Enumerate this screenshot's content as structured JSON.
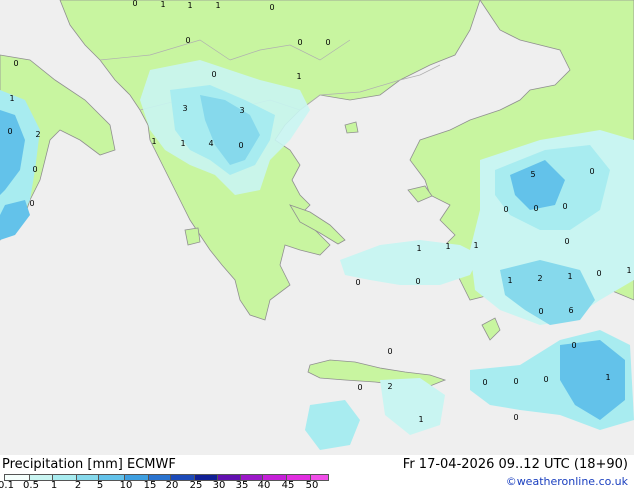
{
  "title": "Precipitation [mm]  ECMWF",
  "valid": "Fr 17-04-2026 09..12 UTC (18+90)",
  "credit": "©weatheronline.co.uk",
  "legend": {
    "ticks": [
      "0.1",
      "0.5",
      "1",
      "2",
      "5",
      "10",
      "15",
      "20",
      "25",
      "30",
      "35",
      "40",
      "45",
      "50"
    ],
    "colors": [
      "#f5fffd",
      "#c9f5f2",
      "#a8ecf0",
      "#86d9ec",
      "#63c2ea",
      "#3f9fe0",
      "#2a73cf",
      "#1c4ab8",
      "#101f95",
      "#6210b0",
      "#9b18c8",
      "#c520d8",
      "#e12ee0",
      "#f04ee8"
    ]
  },
  "colors": {
    "land": "#c8f5a0",
    "sea": "#efefef",
    "coast": "#909090",
    "border": "#b0b0b0"
  },
  "values": [
    {
      "v": "0"
    },
    {
      "v": "1"
    },
    {
      "v": "1"
    },
    {
      "v": "1"
    },
    {
      "v": "0"
    },
    {
      "v": "0"
    },
    {
      "v": "0"
    },
    {
      "v": "0"
    },
    {
      "v": "0"
    },
    {
      "v": "0"
    },
    {
      "v": "1"
    },
    {
      "v": "1"
    },
    {
      "v": "3"
    },
    {
      "v": "3"
    },
    {
      "v": "0"
    },
    {
      "v": "2"
    },
    {
      "v": "1"
    },
    {
      "v": "1"
    },
    {
      "v": "4"
    },
    {
      "v": "0"
    },
    {
      "v": "0"
    },
    {
      "v": "5"
    },
    {
      "v": "0"
    },
    {
      "v": "0"
    },
    {
      "v": "0"
    },
    {
      "v": "0"
    },
    {
      "v": "0"
    },
    {
      "v": "1"
    },
    {
      "v": "1"
    },
    {
      "v": "1"
    },
    {
      "v": "0"
    },
    {
      "v": "0"
    },
    {
      "v": "1"
    },
    {
      "v": "2"
    },
    {
      "v": "1"
    },
    {
      "v": "0"
    },
    {
      "v": "1"
    },
    {
      "v": "0"
    },
    {
      "v": "6"
    },
    {
      "v": "0"
    },
    {
      "v": "0"
    },
    {
      "v": "0"
    },
    {
      "v": "2"
    },
    {
      "v": "0"
    },
    {
      "v": "0"
    },
    {
      "v": "0"
    },
    {
      "v": "1"
    },
    {
      "v": "0"
    },
    {
      "v": "1"
    },
    {
      "v": "0"
    }
  ]
}
